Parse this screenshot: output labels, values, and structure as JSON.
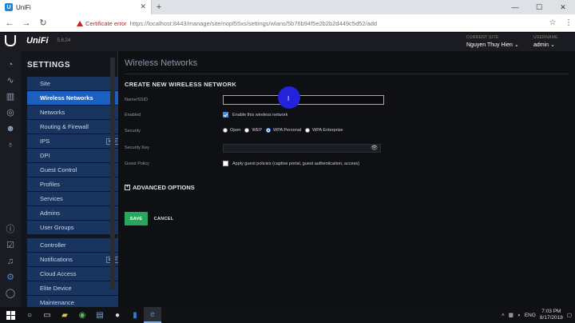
{
  "browser": {
    "tab_title": "UniFi",
    "tab_favicon": "U",
    "newtab_glyph": "+",
    "back_glyph": "←",
    "forward_glyph": "→",
    "reload_glyph": "↻",
    "cert_error": "Certificate error",
    "url": "https://localhost:8443/manage/site/nopl55xs/settings/wlans/5b76b94f5e2b2b2d449c5d52/add",
    "star_glyph": "☆",
    "menu_glyph": "⋮"
  },
  "header": {
    "brand": "UniFi",
    "version": "5.8.24",
    "site_label": "CURRENT SITE",
    "site_value": "Nguyen Thuy Hien",
    "user_label": "USERNAME",
    "user_value": "admin"
  },
  "sidebar": {
    "title": "SETTINGS",
    "items": [
      {
        "label": "Site"
      },
      {
        "label": "Wireless Networks"
      },
      {
        "label": "Networks"
      },
      {
        "label": "Routing & Firewall"
      },
      {
        "label": "IPS",
        "badge": "BETA"
      },
      {
        "label": "DPI"
      },
      {
        "label": "Guest Control"
      },
      {
        "label": "Profiles"
      },
      {
        "label": "Services"
      },
      {
        "label": "Admins"
      },
      {
        "label": "User Groups"
      },
      {
        "label": "Controller"
      },
      {
        "label": "Notifications",
        "badge": "BETA"
      },
      {
        "label": "Cloud Access"
      },
      {
        "label": "Elite Device"
      },
      {
        "label": "Maintenance"
      }
    ]
  },
  "main": {
    "page_title": "Wireless Networks",
    "section_title": "CREATE NEW WIRELESS NETWORK",
    "name_label": "Name/SSID",
    "name_value": "",
    "cursor_glyph": "I",
    "enabled_label": "Enabled",
    "enabled_text": "Enable this wireless network",
    "enabled_checked": true,
    "security_label": "Security",
    "security_options": [
      "Open",
      "WEP",
      "WPA Personal",
      "WPA Enterprise"
    ],
    "security_selected": "WPA Personal",
    "security_key_label": "Security Key",
    "eye_glyph": "👁",
    "guest_label": "Guest Policy",
    "guest_text": "Apply guest policies (captive portal, guest authentication, access)",
    "guest_checked": false,
    "advanced_label": "ADVANCED OPTIONS",
    "advanced_glyph": "+",
    "save_label": "SAVE",
    "cancel_label": "CANCEL"
  },
  "taskbar": {
    "language": "ENG",
    "time": "7:03 PM",
    "date": "8/17/2018"
  },
  "colors": {
    "accent_blue": "#1b5fbf",
    "save_green": "#2aa55f",
    "cert_red": "#c5221f"
  }
}
